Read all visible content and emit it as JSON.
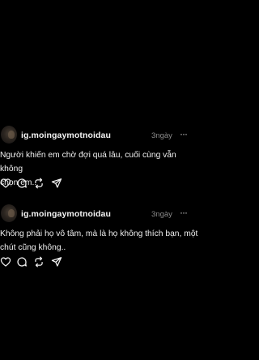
{
  "posts": [
    {
      "username": "ig.moingaymotnoidau",
      "time": "3ngày",
      "line1": "Người khiến em chờ đợi quá lâu, cuối cùng vẫn không",
      "line2": "chọn em..",
      "more_label": "···"
    },
    {
      "username": "ig.moingaymotnoidau",
      "time": "3ngày",
      "line1": "Không phải họ vô tâm, mà là họ không thích bạn, một",
      "line2": "chút cũng không..",
      "more_label": "···"
    }
  ],
  "icons": [
    "heart-icon",
    "comment-icon",
    "repost-icon",
    "share-icon",
    "more-icon"
  ],
  "colors": {
    "background": "#000000",
    "text": "#f0f0f0",
    "muted": "#8a8a8a"
  }
}
